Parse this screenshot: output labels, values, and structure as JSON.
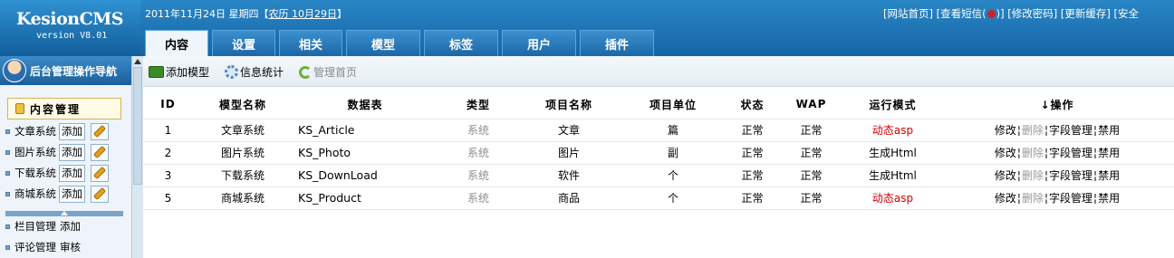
{
  "app": {
    "name": "KesionCMS",
    "version": "version V8.01"
  },
  "header": {
    "date": "2011年11月24日 星期四【",
    "lunar": "农历 10月29日",
    "date_end": "】",
    "links": [
      "[网站首页]",
      "[查看短信(",
      ")]",
      "[修改密码]",
      "[更新缓存]",
      "[安全"
    ]
  },
  "tabs": [
    "内容",
    "设置",
    "相关",
    "模型",
    "标签",
    "用户",
    "插件"
  ],
  "active_tab": "内容",
  "sidebar": {
    "title": "后台管理操作导航",
    "section": "内容管理",
    "items": [
      {
        "label": "文章系统",
        "add": "添加"
      },
      {
        "label": "图片系统",
        "add": "添加"
      },
      {
        "label": "下载系统",
        "add": "添加"
      },
      {
        "label": "商城系统",
        "add": "添加"
      }
    ],
    "extra": [
      {
        "label": "栏目管理",
        "action": "添加"
      },
      {
        "label": "评论管理",
        "action": "审核"
      }
    ]
  },
  "toolbar": {
    "add_model": "添加模型",
    "stats": "信息统计",
    "manage_home": "管理首页"
  },
  "table": {
    "headers": [
      "ID",
      "模型名称",
      "数据表",
      "类型",
      "项目名称",
      "项目单位",
      "状态",
      "WAP",
      "运行模式",
      "↓操作"
    ],
    "rows": [
      {
        "id": "1",
        "name": "文章系统",
        "table": "KS_Article",
        "type": "系统",
        "item": "文章",
        "unit": "篇",
        "status": "正常",
        "wap": "正常",
        "mode": "动态asp",
        "mode_red": true
      },
      {
        "id": "2",
        "name": "图片系统",
        "table": "KS_Photo",
        "type": "系统",
        "item": "图片",
        "unit": "副",
        "status": "正常",
        "wap": "正常",
        "mode": "生成Html",
        "mode_red": false
      },
      {
        "id": "3",
        "name": "下载系统",
        "table": "KS_DownLoad",
        "type": "系统",
        "item": "软件",
        "unit": "个",
        "status": "正常",
        "wap": "正常",
        "mode": "生成Html",
        "mode_red": false
      },
      {
        "id": "5",
        "name": "商城系统",
        "table": "KS_Product",
        "type": "系统",
        "item": "商品",
        "unit": "个",
        "status": "正常",
        "wap": "正常",
        "mode": "动态asp",
        "mode_red": true
      }
    ],
    "ops": {
      "edit": "修改",
      "delete": "删除",
      "fields": "字段管理",
      "disable": "禁用",
      "sep": "¦"
    }
  },
  "colors": {
    "header": "#1f6fae",
    "red": "#d00000",
    "gray": "#8f8f8f"
  }
}
